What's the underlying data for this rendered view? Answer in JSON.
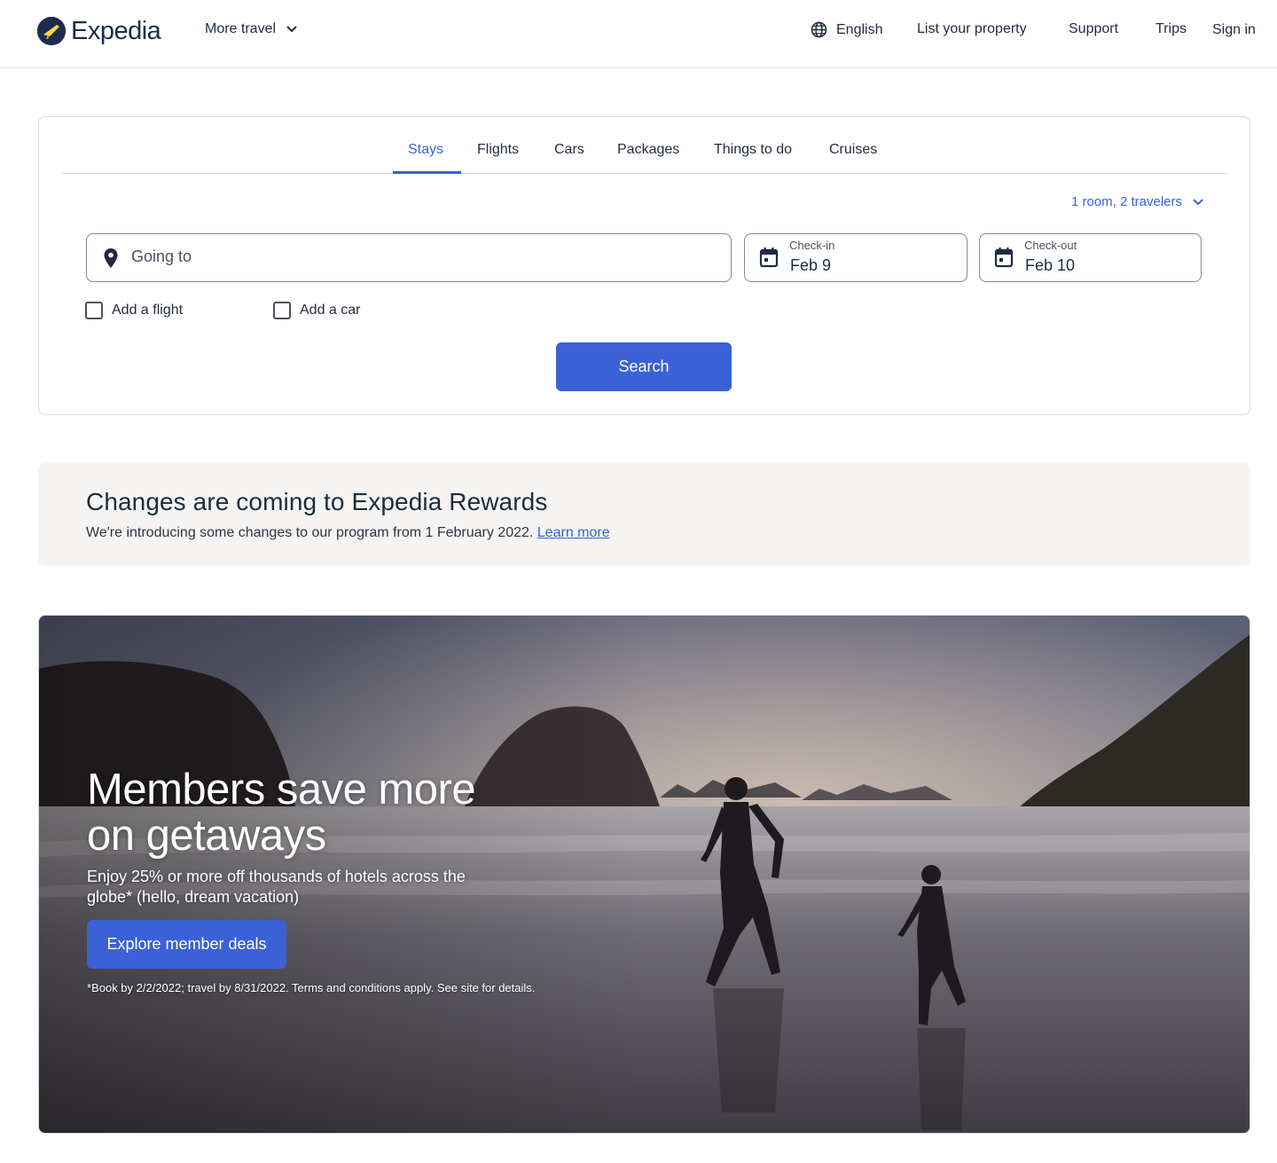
{
  "header": {
    "brand": "Expedia",
    "more_travel": "More travel",
    "language": "English",
    "list_property": "List your property",
    "support": "Support",
    "trips": "Trips",
    "sign_in": "Sign in"
  },
  "search": {
    "tabs": [
      {
        "label": "Stays",
        "active": true
      },
      {
        "label": "Flights",
        "active": false
      },
      {
        "label": "Cars",
        "active": false
      },
      {
        "label": "Packages",
        "active": false
      },
      {
        "label": "Things to do",
        "active": false
      },
      {
        "label": "Cruises",
        "active": false
      }
    ],
    "travelers": "1 room, 2 travelers",
    "going_to_placeholder": "Going to",
    "checkin_label": "Check-in",
    "checkin_value": "Feb 9",
    "checkout_label": "Check-out",
    "checkout_value": "Feb 10",
    "add_flight": "Add a flight",
    "add_car": "Add a car",
    "search_button": "Search"
  },
  "rewards": {
    "title": "Changes are coming to Expedia Rewards",
    "text": "We're introducing some changes to our program from 1 February 2022.",
    "link": "Learn more"
  },
  "hero": {
    "title": "Members save more on getaways",
    "subtitle": "Enjoy 25% or more off thousands of hotels across the globe* (hello, dream vacation)",
    "button": "Explore member deals",
    "fine_print": "*Book by 2/2/2022; travel by 8/31/2022. Terms and conditions apply. See site for details."
  },
  "colors": {
    "accent": "#3a61d6",
    "link": "#3662d8",
    "brand_navy": "#1f2b4d",
    "banner_bg": "#f5f4f2"
  },
  "icons": {
    "logo": "plane-globe-icon",
    "language": "globe-icon",
    "destination": "map-pin-icon",
    "date": "calendar-icon",
    "dropdown": "chevron-down-icon"
  }
}
